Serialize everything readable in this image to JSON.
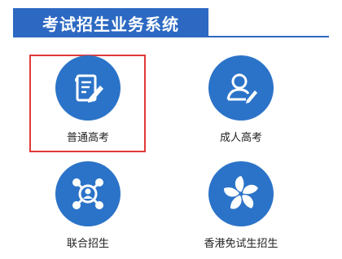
{
  "header": {
    "title": "考试招生业务系统"
  },
  "colors": {
    "accent": "#2d69c2",
    "tile_circle": "#2b73c8",
    "selection": "#e03a3a"
  },
  "tiles": [
    {
      "label": "普通高考",
      "icon": "document-edit-icon",
      "selected": true
    },
    {
      "label": "成人高考",
      "icon": "person-edit-icon",
      "selected": false
    },
    {
      "label": "联合招生",
      "icon": "network-person-icon",
      "selected": false
    },
    {
      "label": "香港免试生招生",
      "icon": "bauhinia-flower-icon",
      "selected": false
    }
  ]
}
